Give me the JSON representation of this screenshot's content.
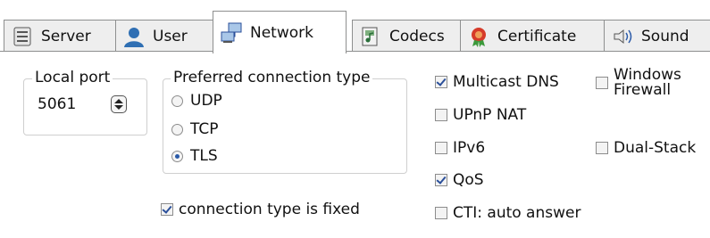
{
  "tabs": [
    {
      "label": "Server",
      "icon": "server-icon",
      "active": false
    },
    {
      "label": "User",
      "icon": "user-icon",
      "active": false
    },
    {
      "label": "Network",
      "icon": "network-icon",
      "active": true
    },
    {
      "label": "Codecs",
      "icon": "codecs-icon",
      "active": false
    },
    {
      "label": "Certificate",
      "icon": "certificate-icon",
      "active": false
    },
    {
      "label": "Sound",
      "icon": "sound-icon",
      "active": false
    }
  ],
  "local_port": {
    "legend": "Local port",
    "value": "5061"
  },
  "connection_type": {
    "legend": "Preferred connection type",
    "options": [
      {
        "label": "UDP",
        "selected": false
      },
      {
        "label": "TCP",
        "selected": false
      },
      {
        "label": "TLS",
        "selected": true
      }
    ],
    "fixed": {
      "label": "connection type is fixed",
      "checked": true
    }
  },
  "options": {
    "multicast_dns": {
      "label": "Multicast DNS",
      "checked": true
    },
    "upnp_nat": {
      "label": "UPnP NAT",
      "checked": false
    },
    "ipv6": {
      "label": "IPv6",
      "checked": false
    },
    "qos": {
      "label": "QoS",
      "checked": true
    },
    "cti_auto_answer": {
      "label": "CTI: auto answer",
      "checked": false
    },
    "windows_firewall": {
      "label_line1": "Windows",
      "label_line2": "Firewall",
      "checked": false
    },
    "dual_stack": {
      "label": "Dual-Stack",
      "checked": false
    }
  },
  "colors": {
    "accent": "#2a5aa8",
    "tab_bg": "#eeeeee",
    "border": "#8e8f8f"
  }
}
